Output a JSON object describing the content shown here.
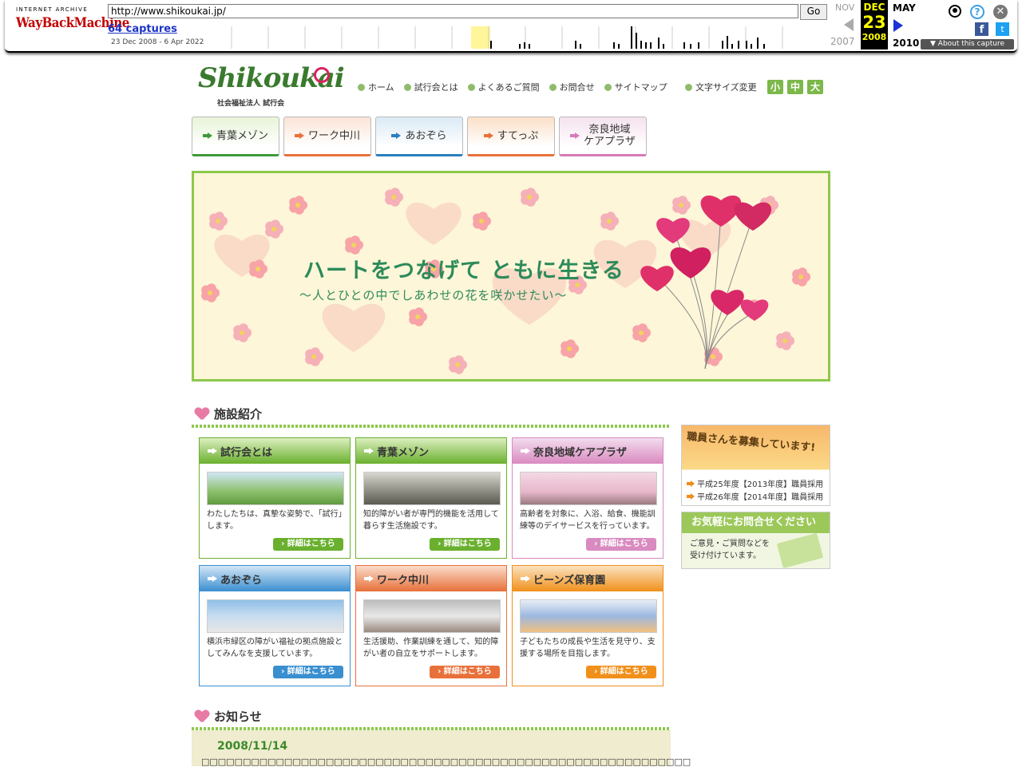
{
  "wayback": {
    "logo_top": "INTERNET ARCHIVE",
    "logo_main": "WayBackMachine",
    "url": "http://www.shikoukai.jp/",
    "go_label": "Go",
    "captures": "64 captures",
    "range": "23 Dec 2008 - 6 Apr 2022",
    "prev_month": "NOV",
    "prev_year": "2007",
    "cur_month": "DEC",
    "cur_day": "23",
    "cur_year": "2008",
    "next_month": "MAY",
    "next_year": "2010",
    "about_label": "▼ About this capture",
    "help_glyph": "?",
    "close_glyph": "✕",
    "fb_glyph": "f",
    "tw_glyph": "t"
  },
  "site": {
    "logo_script": "Shikoukai",
    "logo_sub": "社会福祉法人 試行会",
    "topnav": [
      "ホーム",
      "試行会とは",
      "よくあるご質問",
      "お問合せ",
      "サイトマップ"
    ],
    "fontsize_label": "文字サイズ変更",
    "fontsize_buttons": [
      "小",
      "中",
      "大"
    ],
    "mainnav": [
      {
        "label": "青葉メゾン",
        "color": "#3e9a3a",
        "bg": "#e8f4d8"
      },
      {
        "label": "ワーク中川",
        "color": "#e8703a",
        "bg": "#fbe4d6"
      },
      {
        "label": "あおぞら",
        "color": "#2a7fc0",
        "bg": "#dbeaf5"
      },
      {
        "label": "すてっぷ",
        "color": "#e8703a",
        "bg": "#fbe0c8"
      },
      {
        "label": "奈良地域\nケアプラザ",
        "color": "#d87ab8",
        "bg": "#f5e2ee"
      }
    ],
    "hero_title": "ハートをつなげて ともに生きる",
    "hero_sub": "〜人とひとの中でしあわせの花を咲かせたい〜",
    "section_facilities": "施設紹介",
    "cards": [
      {
        "title": "試行会とは",
        "desc": "わたしたちは、真摯な姿勢で、「試行」します。",
        "btn": "› 詳細はこちら",
        "color": "#6ab02e",
        "head_bg": "#dcefc0"
      },
      {
        "title": "青葉メゾン",
        "desc": "知的障がい者が専門的機能を活用して暮らす生活施設です。",
        "btn": "› 詳細はこちら",
        "color": "#6ab02e",
        "head_bg": "#dcefc0"
      },
      {
        "title": "奈良地域ケアプラザ",
        "desc": "高齢者を対象に、入浴、給食、機能訓練等のデイサービスを行っています。",
        "btn": "› 詳細はこちら",
        "color": "#d98ac0",
        "head_bg": "#f3dced"
      },
      {
        "title": "あおぞら",
        "desc": "横浜市緑区の障がい福祉の拠点施設としてみんなを支援しています。",
        "btn": "› 詳細はこちら",
        "color": "#3a8fd0",
        "head_bg": "#d4e6f6"
      },
      {
        "title": "ワーク中川",
        "desc": "生活援助、作業訓練を通して、知的障がい者の自立をサポートします。",
        "btn": "› 詳細はこちら",
        "color": "#e8703a",
        "head_bg": "#fadccb"
      },
      {
        "title": "ビーンズ保育園",
        "desc": "子どもたちの成長や生活を見守り、支援する場所を目指します。",
        "btn": "› 詳細はこちら",
        "color": "#f0901a",
        "head_bg": "#fbe2c0"
      }
    ],
    "recruit_title": "職員さんを募集しています!",
    "recruit_items": [
      "平成25年度【2013年度】職員採用",
      "平成26年度【2014年度】職員採用"
    ],
    "contact_title": "お気軽にお問合せください",
    "contact_text": "ご意見・ご質問などを\n受け付けています。",
    "section_news": "お知らせ",
    "news_date": "2008/11/14",
    "news_body": "□□□□□□□□□□□□□□□□□□□□□□□□□□□□□□□□□□□□□□□□□□□□□□□□□□□□□□□□□□□"
  }
}
